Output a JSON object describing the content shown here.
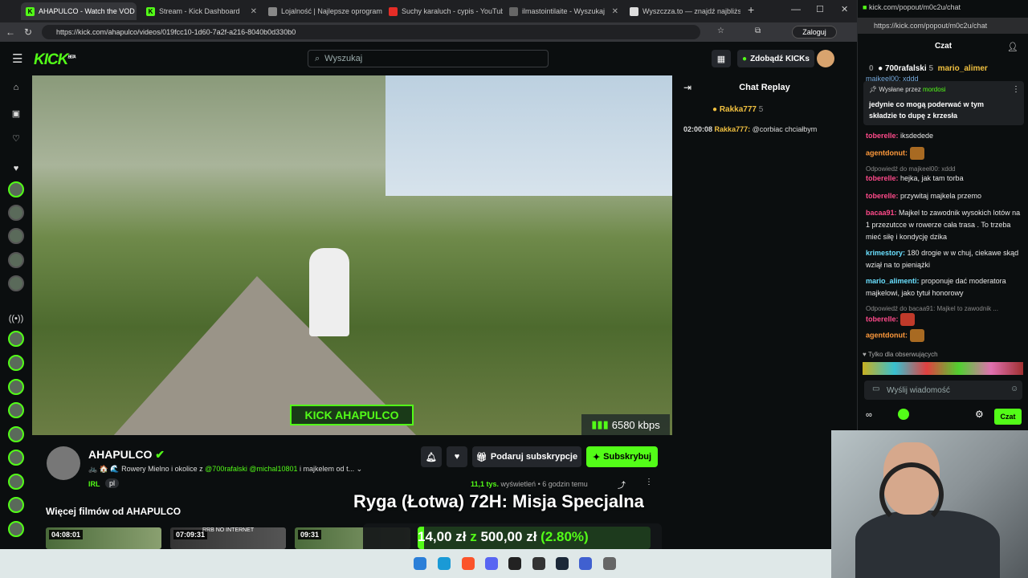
{
  "browser": {
    "tabs": [
      {
        "label": "AHAPULCO - Watch the VOD",
        "icon": "kick-icon",
        "active": true
      },
      {
        "label": "Stream - Kick Dashboard",
        "icon": "kick-icon"
      },
      {
        "label": "Lojalność | Najlepsze oprogram",
        "icon": "tab-icon"
      },
      {
        "label": "Suchy karaluch - cypis - YouTube",
        "icon": "youtube-icon"
      },
      {
        "label": "ilmastointilaite - Wyszukaj",
        "icon": "search-icon"
      },
      {
        "label": "Wyszczza.to — znajdź najbliższa",
        "icon": "tab-icon"
      }
    ],
    "url": "https://kick.com/ahapulco/videos/019fcc10-1d60-7a2f-a216-8040b0d330b0",
    "login_label": "Zaloguj"
  },
  "kick": {
    "logo": "KICK",
    "logo_beta": "BETA",
    "search_placeholder": "Wyszukaj",
    "kicks_label": "Zdobądź KICKs"
  },
  "video": {
    "overlay_tag": "KICK AHAPULCO",
    "bitrate": "6580 kbps"
  },
  "replay": {
    "title": "Chat Replay",
    "top_user": "Rakka777",
    "top_count": "5",
    "messages": [
      {
        "time": "02:00:08",
        "user": "Rakka777:",
        "text": "@corbiac chciałbym"
      }
    ]
  },
  "channel": {
    "name": "AHAPULCO",
    "description": "🚲 🏠 🌊 Rowery Mielno i okolice z",
    "mention1": "@700rafalski",
    "mention2": "@michal10801",
    "desc_tail": "i majkelem od t...",
    "category": "IRL",
    "language": "pl",
    "views": "11,1 tys.",
    "views_label": "wyświetleń",
    "age": "6 godzin temu",
    "subs_gift_label": "Podaruj subskrypcje",
    "subscribe_label": "Subskrybuj",
    "more_videos_title": "Więcej filmów od AHAPULCO",
    "thumbs": [
      {
        "duration": "04:08:01"
      },
      {
        "duration": "07:09:31",
        "caption": "RRB NO INTERNET"
      },
      {
        "duration": "09:31"
      }
    ]
  },
  "popout": {
    "url": "kick.com/popout/m0c2u/chat",
    "url_full": "https://kick.com/popout/m0c2u/chat",
    "title": "Czat",
    "leaderboard": [
      {
        "rank": "0",
        "user": "700rafalski",
        "count": "5"
      },
      {
        "user": "mario_alimer"
      }
    ],
    "pinned_by_label": "Wysłane przez",
    "pinned_by_user": "mordosi",
    "pinned_text": "jedynie co mogą poderwać w tym składzie to dupę z krzesła",
    "cut_top": "majkeel00: xddd",
    "messages": [
      {
        "user": "toberelle:",
        "text": "iksdedede",
        "cls": "u1"
      },
      {
        "user": "agentdonut:",
        "text": "",
        "cls": "u2",
        "emote": true
      },
      {
        "reply": "Odpowiedź do majkeel00: xddd"
      },
      {
        "user": "toberelle:",
        "text": "hejka, jak tam torba",
        "cls": "u1"
      },
      {
        "user": "toberelle:",
        "text": "przywitaj majkela przemo",
        "cls": "u1"
      },
      {
        "user": "bacaa91:",
        "text": "Majkel to zawodnik wysokich lotów na 1 przezutcce w rowerze cała trasa . To trzeba mieć siłę i kondycję dzika",
        "cls": "u1"
      },
      {
        "user": "krimestory:",
        "text": "180 drogie w w chuj, ciekawe skąd wziął na to pieniążki",
        "cls": "u3"
      },
      {
        "user": "mario_alimenti:",
        "text": "proponuje dać moderatora majkelowi, jako tytuł honorowy",
        "cls": "u3"
      },
      {
        "reply": "Odpowiedź do bacaa91: Majkel to zawodnik ..."
      },
      {
        "user": "toberelle:",
        "text": "",
        "cls": "u1",
        "emote": true
      },
      {
        "user": "agentdonut:",
        "text": "",
        "cls": "u2",
        "emote": true
      }
    ],
    "followers_only": "Tylko dla obserwujących",
    "input_placeholder": "Wyślij wiadomość",
    "send_label": "Czat"
  },
  "overlay": {
    "banner": "Ryga (Łotwa) 72H: Misja Specjalna",
    "goal_current": "14,00 zł",
    "goal_mid": "z",
    "goal_target": "500,00 zł",
    "goal_pct": "(2.80%)",
    "goal_progress": 0.028
  }
}
